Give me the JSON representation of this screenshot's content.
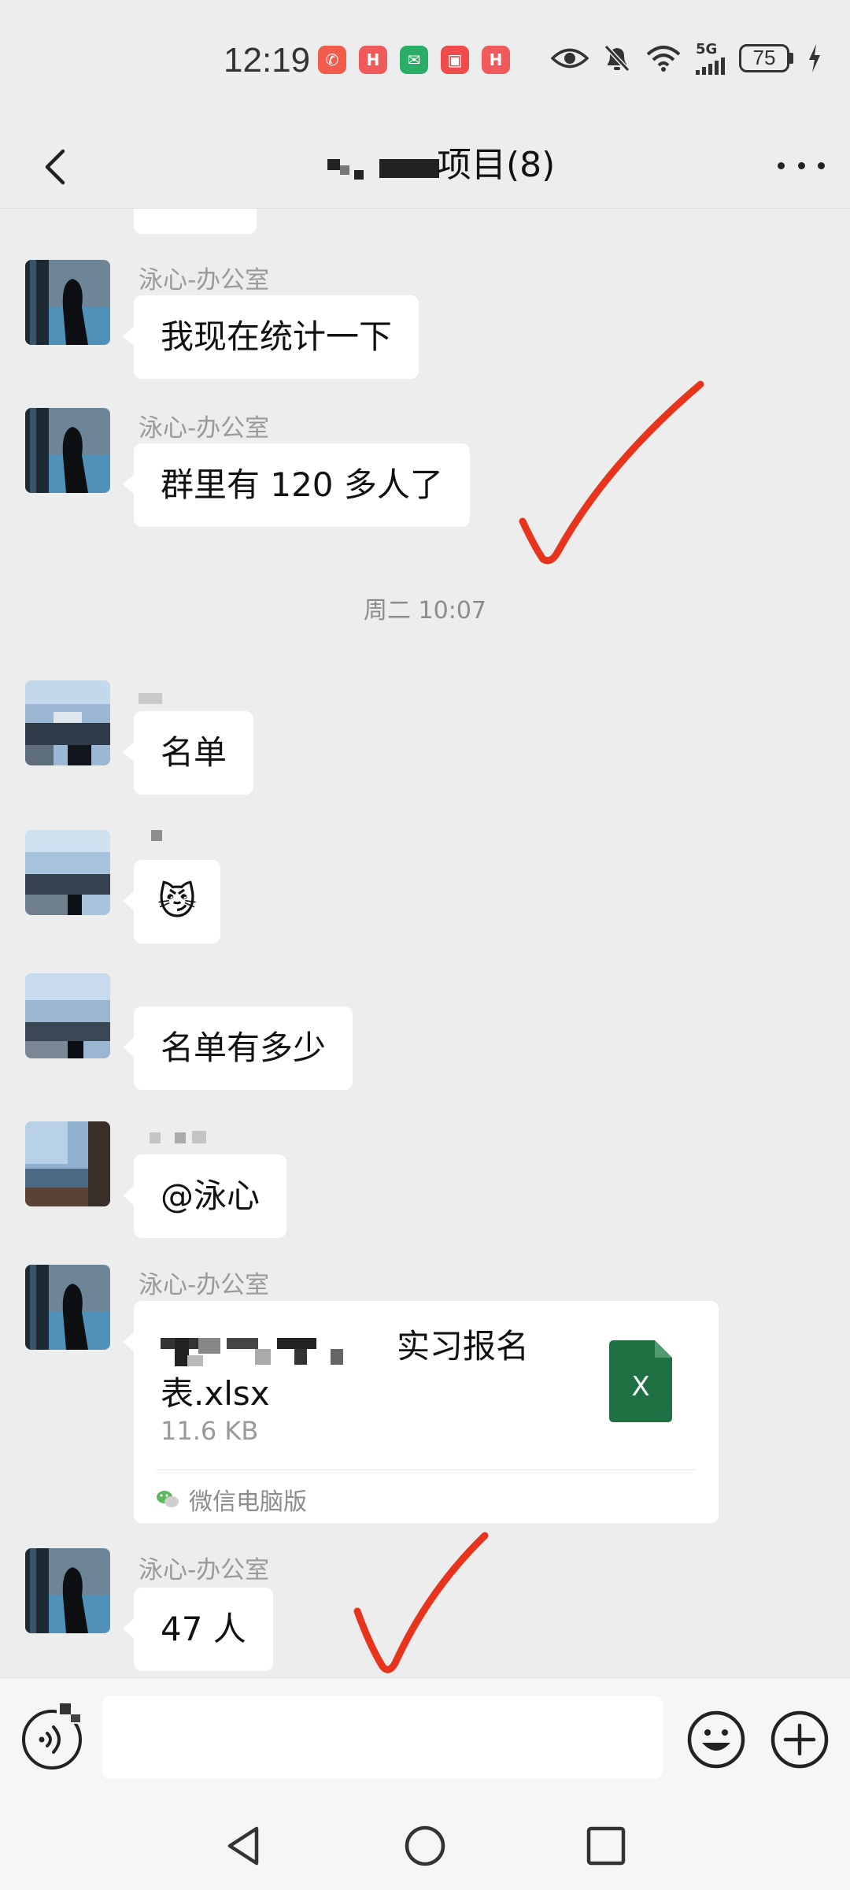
{
  "status_bar": {
    "time": "12:19",
    "notifications": [
      {
        "name": "missed-call-icon",
        "color": "#f25c4c",
        "glyph": "✆"
      },
      {
        "name": "huawei-app-icon",
        "color": "#f05a5a",
        "glyph": "H"
      },
      {
        "name": "wechat-icon",
        "color": "#2aae67",
        "glyph": "✉"
      },
      {
        "name": "books-icon",
        "color": "#ef4b4b",
        "glyph": "▣"
      },
      {
        "name": "huawei-store-icon",
        "color": "#f05a5a",
        "glyph": "H"
      }
    ],
    "network_label": "5G",
    "battery": "75"
  },
  "header": {
    "title": "项目(8)"
  },
  "messages": [
    {
      "sender": "泳心-办公室",
      "text": "我现在统计一下"
    },
    {
      "sender": "泳心-办公室",
      "text": "群里有 120 多人了"
    },
    {
      "sender": "",
      "text": "名单"
    },
    {
      "sender": "",
      "text": "😼"
    },
    {
      "sender": "",
      "text": "名单有多少"
    },
    {
      "sender": "",
      "text": "@泳心"
    },
    {
      "sender": "泳心-办公室",
      "text": "47 人"
    }
  ],
  "time_separator": "周二 10:07",
  "file_message": {
    "sender": "泳心-办公室",
    "name_visible_part": "实习报名",
    "name_line2": "表.xlsx",
    "size": "11.6 KB",
    "source": "微信电脑版",
    "icon_letter": "X"
  },
  "input": {
    "value": "",
    "placeholder": ""
  },
  "colors": {
    "background": "#ededed",
    "bubble": "#ffffff",
    "excel_green": "#1f7144",
    "annotation_red": "#e8341c"
  }
}
